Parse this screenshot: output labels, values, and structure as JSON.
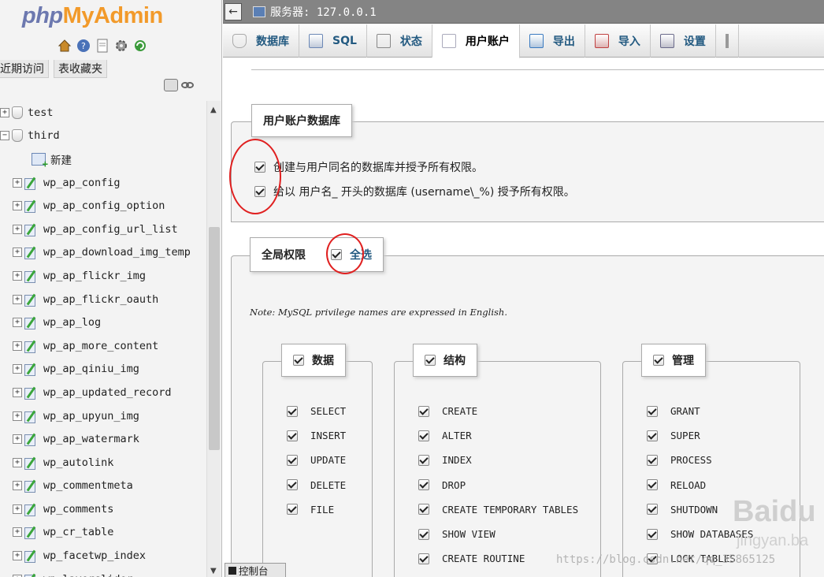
{
  "nav": {
    "logo_php": "php",
    "logo_myadmin": "MyAdmin",
    "tabs": [
      "近期访问",
      "表收藏夹"
    ],
    "tree": [
      {
        "type": "db",
        "expand": "+",
        "label": "test"
      },
      {
        "type": "db",
        "expand": "−",
        "label": "third"
      },
      {
        "type": "new",
        "label": "新建"
      },
      {
        "type": "table",
        "label": "wp_ap_config"
      },
      {
        "type": "table",
        "label": "wp_ap_config_option"
      },
      {
        "type": "table",
        "label": "wp_ap_config_url_list"
      },
      {
        "type": "table",
        "label": "wp_ap_download_img_temp"
      },
      {
        "type": "table",
        "label": "wp_ap_flickr_img"
      },
      {
        "type": "table",
        "label": "wp_ap_flickr_oauth"
      },
      {
        "type": "table",
        "label": "wp_ap_log"
      },
      {
        "type": "table",
        "label": "wp_ap_more_content"
      },
      {
        "type": "table",
        "label": "wp_ap_qiniu_img"
      },
      {
        "type": "table",
        "label": "wp_ap_updated_record"
      },
      {
        "type": "table",
        "label": "wp_ap_upyun_img"
      },
      {
        "type": "table",
        "label": "wp_ap_watermark"
      },
      {
        "type": "table",
        "label": "wp_autolink"
      },
      {
        "type": "table",
        "label": "wp_commentmeta"
      },
      {
        "type": "table",
        "label": "wp_comments"
      },
      {
        "type": "table",
        "label": "wp_cr_table"
      },
      {
        "type": "table",
        "label": "wp_facetwp_index"
      },
      {
        "type": "table",
        "label": "wp_layerslider"
      }
    ]
  },
  "topbar": {
    "server_label": "服务器: 127.0.0.1"
  },
  "menu": {
    "tabs": [
      {
        "label": "数据库",
        "active": false
      },
      {
        "label": "SQL",
        "active": false
      },
      {
        "label": "状态",
        "active": false
      },
      {
        "label": "用户账户",
        "active": true
      },
      {
        "label": "导出",
        "active": false
      },
      {
        "label": "导入",
        "active": false
      },
      {
        "label": "设置",
        "active": false
      }
    ]
  },
  "user_db": {
    "legend": "用户账户数据库",
    "opt1": "创建与用户同名的数据库并授予所有权限。",
    "opt2": "给以 用户名_ 开头的数据库 (username\\_%) 授予所有权限。"
  },
  "global": {
    "legend": "全局权限",
    "select_all": "全选",
    "note": "Note: MySQL privilege names are expressed in English."
  },
  "groups": [
    {
      "title": "数据",
      "items": [
        "SELECT",
        "INSERT",
        "UPDATE",
        "DELETE",
        "FILE"
      ]
    },
    {
      "title": "结构",
      "items": [
        "CREATE",
        "ALTER",
        "INDEX",
        "DROP",
        "CREATE TEMPORARY TABLES",
        "SHOW VIEW",
        "CREATE ROUTINE"
      ]
    },
    {
      "title": "管理",
      "items": [
        "GRANT",
        "SUPER",
        "PROCESS",
        "RELOAD",
        "SHUTDOWN",
        "SHOW DATABASES",
        "LOCK TABLES"
      ]
    }
  ],
  "console_label": "控制台",
  "watermark": "https://blog.csdn.net/qq_35865125",
  "baidu_watermark": "Baidu",
  "jingyan_watermark": "jingyan.ba",
  "colors": {
    "link": "#235a81",
    "annotation_circle": "#e02020",
    "logo_php": "#6c78af",
    "logo_myadmin": "#f29a2a"
  }
}
